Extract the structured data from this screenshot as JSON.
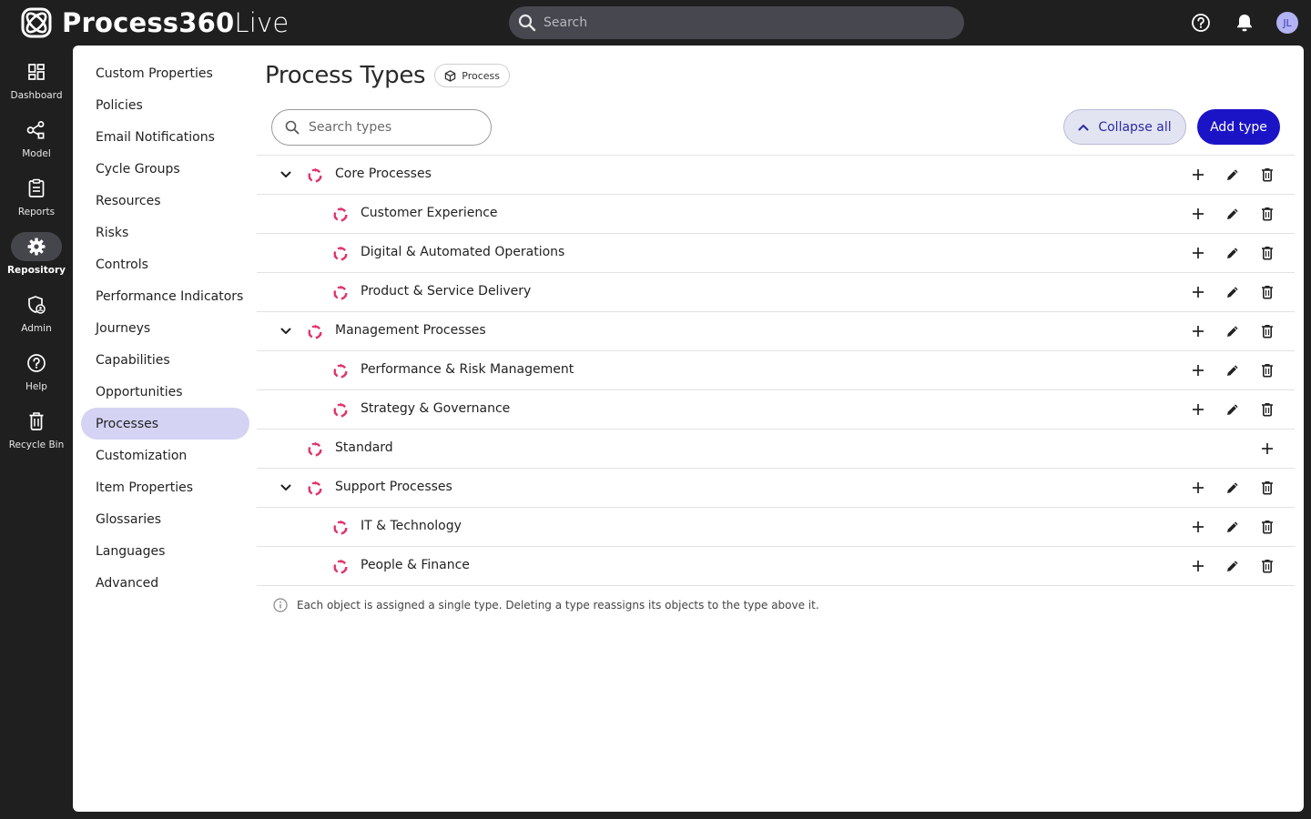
{
  "app": {
    "brand_bold": "Process360",
    "brand_light": "Live",
    "search_placeholder": "Search",
    "user_initials": "JL"
  },
  "rail": [
    {
      "label": "Dashboard",
      "icon": "dashboard-icon"
    },
    {
      "label": "Model",
      "icon": "model-icon"
    },
    {
      "label": "Reports",
      "icon": "reports-icon"
    },
    {
      "label": "Repository",
      "icon": "gear-icon",
      "active": true
    },
    {
      "label": "Admin",
      "icon": "admin-shield-icon"
    },
    {
      "label": "Help",
      "icon": "help-icon"
    },
    {
      "label": "Recycle Bin",
      "icon": "trash-icon"
    }
  ],
  "sidenav": [
    "Custom Properties",
    "Policies",
    "Email Notifications",
    "Cycle Groups",
    "Resources",
    "Risks",
    "Controls",
    "Performance Indicators",
    "Journeys",
    "Capabilities",
    "Opportunities",
    "Processes",
    "Customization",
    "Item Properties",
    "Glossaries",
    "Languages",
    "Advanced"
  ],
  "sidenav_active": "Processes",
  "page": {
    "title": "Process Types",
    "chip": "Process",
    "search_placeholder": "Search types",
    "collapse_label": "Collapse all",
    "add_label": "Add type",
    "note": "Each object is assigned a single type. Deleting a type reassigns its objects to the type above it."
  },
  "tree": [
    {
      "label": "Core Processes",
      "level": 0,
      "expandable": true,
      "actions": [
        "add",
        "edit",
        "delete"
      ]
    },
    {
      "label": "Customer Experience",
      "level": 1,
      "expandable": false,
      "actions": [
        "add",
        "edit",
        "delete"
      ]
    },
    {
      "label": "Digital & Automated Operations",
      "level": 1,
      "expandable": false,
      "actions": [
        "add",
        "edit",
        "delete"
      ]
    },
    {
      "label": "Product & Service Delivery",
      "level": 1,
      "expandable": false,
      "actions": [
        "add",
        "edit",
        "delete"
      ]
    },
    {
      "label": "Management Processes",
      "level": 0,
      "expandable": true,
      "actions": [
        "add",
        "edit",
        "delete"
      ]
    },
    {
      "label": "Performance & Risk Management",
      "level": 1,
      "expandable": false,
      "actions": [
        "add",
        "edit",
        "delete"
      ]
    },
    {
      "label": "Strategy & Governance",
      "level": 1,
      "expandable": false,
      "actions": [
        "add",
        "edit",
        "delete"
      ]
    },
    {
      "label": "Standard",
      "level": 0,
      "expandable": false,
      "actions": [
        "add"
      ]
    },
    {
      "label": "Support Processes",
      "level": 0,
      "expandable": true,
      "actions": [
        "add",
        "edit",
        "delete"
      ]
    },
    {
      "label": "IT & Technology",
      "level": 1,
      "expandable": false,
      "actions": [
        "add",
        "edit",
        "delete"
      ]
    },
    {
      "label": "People & Finance",
      "level": 1,
      "expandable": false,
      "actions": [
        "add",
        "edit",
        "delete"
      ]
    }
  ],
  "colors": {
    "accent": "#1b14c7",
    "active_nav": "#d4d3f4",
    "type_icon": "#e0356a",
    "chrome": "#1f1f1f"
  }
}
